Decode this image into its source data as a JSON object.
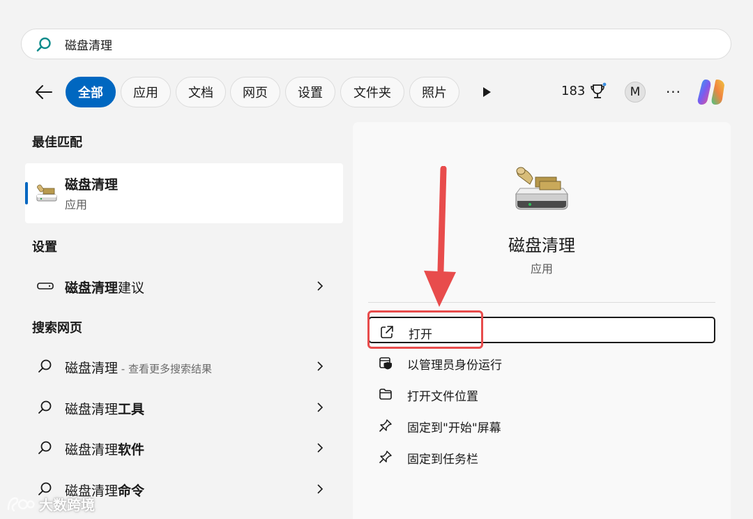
{
  "search": {
    "query": "磁盘清理"
  },
  "filters": [
    {
      "label": "全部",
      "active": true
    },
    {
      "label": "应用",
      "active": false
    },
    {
      "label": "文档",
      "active": false
    },
    {
      "label": "网页",
      "active": false
    },
    {
      "label": "设置",
      "active": false
    },
    {
      "label": "文件夹",
      "active": false
    },
    {
      "label": "照片",
      "active": false
    }
  ],
  "header": {
    "points": "183",
    "avatar_initial": "M",
    "more": "···"
  },
  "best_match": {
    "section_title": "最佳匹配",
    "name": "磁盘清理",
    "type": "应用"
  },
  "settings": {
    "section_title": "设置",
    "items": [
      {
        "bold": "磁盘清理",
        "rest": "建议"
      }
    ]
  },
  "web": {
    "section_title": "搜索网页",
    "items": [
      {
        "plain": "磁盘清理",
        "note": " - 查看更多搜索结果",
        "bold": ""
      },
      {
        "plain": "磁盘清理",
        "note": "",
        "bold": "工具"
      },
      {
        "plain": "磁盘清理",
        "note": "",
        "bold": "软件"
      },
      {
        "plain": "磁盘清理",
        "note": "",
        "bold": "命令"
      }
    ]
  },
  "detail": {
    "name": "磁盘清理",
    "type": "应用",
    "actions": [
      {
        "label": "打开",
        "icon": "open-external-icon"
      },
      {
        "label": "以管理员身份运行",
        "icon": "shield-admin-icon"
      },
      {
        "label": "打开文件位置",
        "icon": "folder-icon"
      },
      {
        "label": "固定到\"开始\"屏幕",
        "icon": "pin-icon"
      },
      {
        "label": "固定到任务栏",
        "icon": "pin-icon"
      }
    ]
  },
  "watermark": {
    "text": "大数跨境"
  },
  "colors": {
    "accent": "#0067c0",
    "annotation": "#e84c4c"
  }
}
